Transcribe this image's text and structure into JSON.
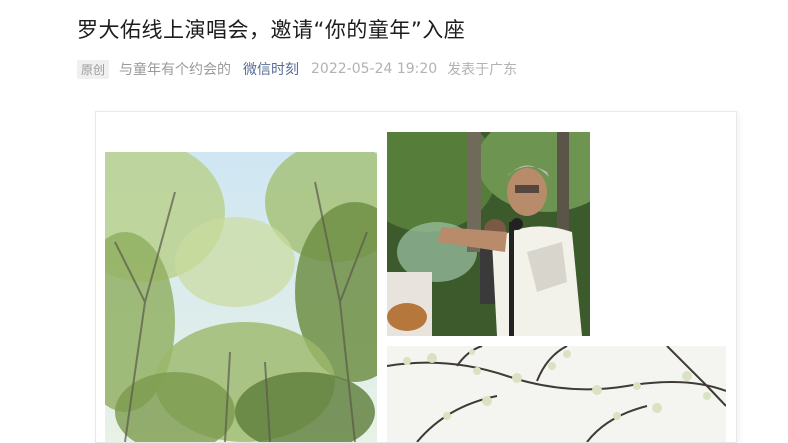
{
  "article": {
    "title": "罗大佑线上演唱会，邀请“你的童年”入座",
    "badge": "原创",
    "author": "与童年有个约会的",
    "account": "微信时刻",
    "datetime": "2022-05-24 19:20",
    "location": "发表于广东"
  },
  "colors": {
    "link": "#576b95",
    "meta_text": "#b2b2b2"
  },
  "images": [
    {
      "name": "tree-tunnel-photo"
    },
    {
      "name": "singer-performing-photo"
    },
    {
      "name": "blossom-branches-photo"
    }
  ]
}
